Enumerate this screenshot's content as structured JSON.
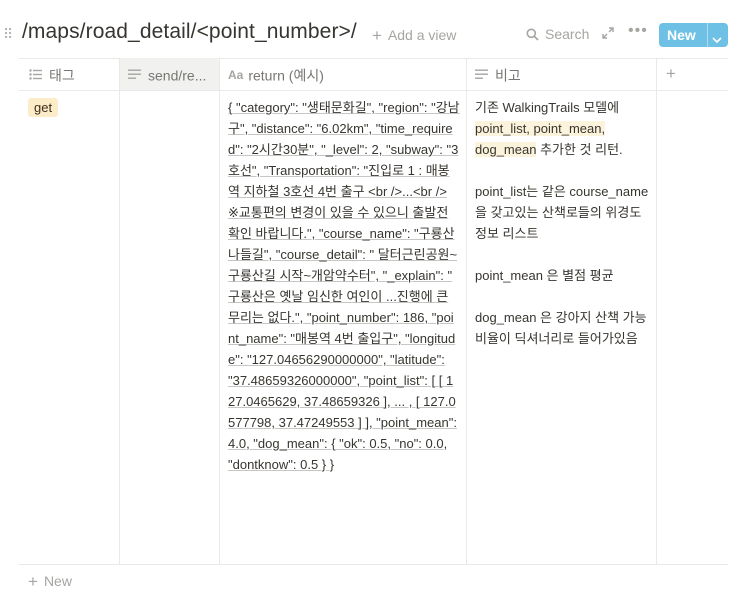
{
  "page": {
    "title": "/maps/road_detail/<point_number>/",
    "add_view": "Add a view",
    "search": "Search",
    "new_button": "New",
    "new_row": "New"
  },
  "columns": [
    {
      "label": "태그",
      "icon": "list-icon"
    },
    {
      "label": "send/re...",
      "icon": "text-icon"
    },
    {
      "label": "return (예시)",
      "icon": "title-icon"
    },
    {
      "label": "비고",
      "icon": "text-icon"
    }
  ],
  "row": {
    "tag": "get",
    "send": "",
    "return_text": "{ \"category\": \"생태문화길\", \"region\": \"강남구\", \"distance\": \"6.02km\", \"time_required\": \"2시간30분\", \"_level\": 2, \"subway\": \"3호선\", \"Transportation\": \"진입로 1 : 매봉역 지하철 3호선 4번 출구 <br />...<br /> ※교통편의 변경이 있을 수 있으니 출발전 확인 바랍니다.\", \"course_name\": \"구룡산 나들길\", \"course_detail\": \" 달터근린공원~구룡산길 시작~개암약수터\", \"_explain\": \" 구룡산은 옛날 임신한 여인이 ...진행에 큰 무리는 없다.\", \"point_number\": 186, \"point_name\": \"매봉역 4번 출입구\", \"longitude\": \"127.04656290000000\", \"latitude\": \"37.48659326000000\", \"point_list\": [ [ 127.0465629, 37.48659326 ], ... , [ 127.0577798, 37.47249553 ] ], \"point_mean\": 4.0, \"dog_mean\": { \"ok\": 0.5, \"no\": 0.0, \"dontknow\": 0.5 } }",
    "note": {
      "p1_a": "기존 WalkingTrails 모델에 ",
      "p1_hl": "point_list, point_mean, dog_mean",
      "p1_b": " 추가한 것 리턴.",
      "p2": "point_list는 같은 course_name을 갖고있는 산책로들의 위경도 정보 리스트",
      "p3": "point_mean 은 별점 평균",
      "p4": "dog_mean 은 강아지 산책 가능 비율이 딕셔너리로 들어가있음"
    }
  }
}
